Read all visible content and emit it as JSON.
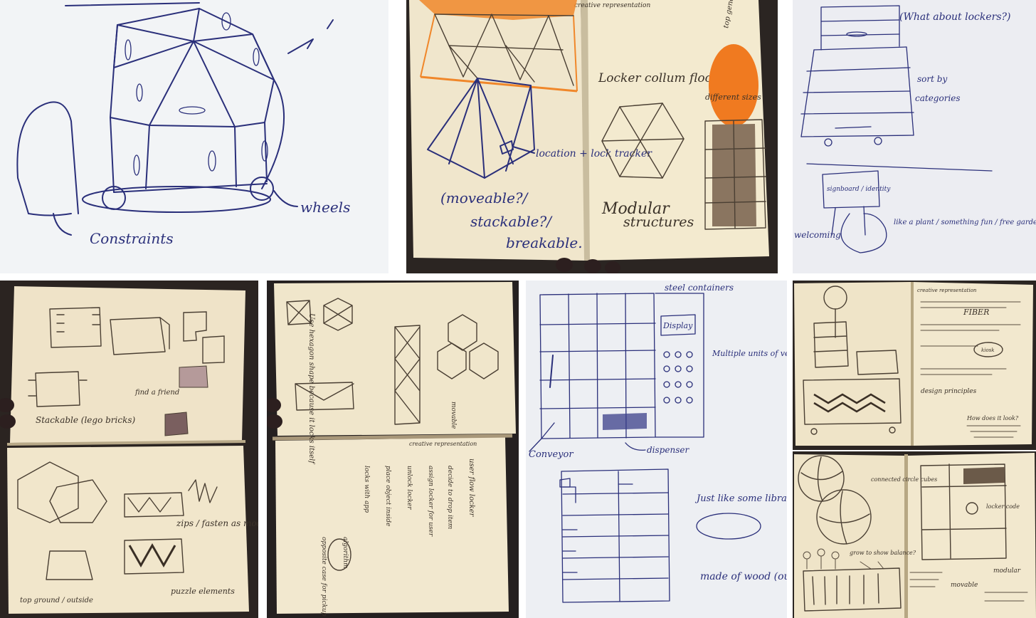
{
  "photos": {
    "sketch_1": {
      "subject": "hexagonal dome locker structure on wheels",
      "labels": {
        "constraints": "Constraints",
        "wheels": "wheels"
      }
    },
    "sketch_2": {
      "subject": "notebook spread with triangle canopy, locker column floor plan and stacked hexagonal lockers",
      "labels": {
        "header": "creative representation",
        "floor_plan": "Locker collum floor plan:",
        "location_lock": "location + lock tracker",
        "movable": "(moveable?/",
        "stackable": "stackable?/",
        "breakable": "breakable.",
        "modular": "Modular",
        "structures": "structures",
        "different_sizes": "different sizes",
        "top_note": "top generally cold?"
      }
    },
    "sketch_3": {
      "subject": "tall stacked shelving unit with pedestal and signage",
      "labels": {
        "what_about_lockers": "(What about lockers?)",
        "sort_by": "sort by",
        "categories": "categories",
        "signboard": "signboard / identity",
        "welcoming": "welcoming",
        "like_a_plant": "like a plant / something fun / free gardens"
      }
    },
    "sketch_4": {
      "subject": "notebook with modular furniture and puzzle-piece sketches",
      "labels": {
        "stackable_lego": "Stackable (lego bricks)",
        "zip_fasten": "zips / fasten as modular elements?",
        "puzzle": "puzzle elements",
        "top_side": "top ground / outside",
        "find_friends": "find a friend"
      }
    },
    "sketch_5": {
      "subject": "notebook spread with hexagon structures and user flow",
      "labels": {
        "header": "creative representation",
        "hexagon_note": "Use hexagon shape because it locks itself",
        "flow_start": "user flow locker",
        "movable": "movable",
        "assign": "assign locker for user",
        "decide": "decide to drop item",
        "unlock": "unlock locker",
        "place": "place object inside",
        "algorithm": "algorithm",
        "lock": "locks with app",
        "opposite": "opposite case for pickup"
      }
    },
    "sketch_6": {
      "subject": "grid vending machine layout and shelf diagram",
      "labels": {
        "steel": "steel containers",
        "display": "Display",
        "buttons": "Multiple units of vending machines",
        "dispenser": "dispenser",
        "conveyor": "Conveyor",
        "library": "Just like some library (in very small one)",
        "wood": "made of wood (outside?)"
      }
    },
    "sketch_7": {
      "subject": "notebook page with lamp, stacked boxes and woven bench",
      "labels": {
        "header": "creative representation",
        "kiosk": "kiosk",
        "design_principles": "design principles",
        "fiber": "FIBER",
        "how_does_it_look": "How does it look?"
      }
    },
    "sketch_8": {
      "subject": "notebook page with connected circles and modular cabinet",
      "labels": {
        "connected": "connected circle cubes",
        "grow": "grow to show balance?",
        "movable": "movable",
        "locker_code": "locker code",
        "modular": "modular"
      }
    }
  },
  "palette": {
    "ballpoint": "#2a2f7a",
    "pencil": "#4a3f33",
    "paper_white": "#f4f4f6",
    "paper_cream": "#f2e8cf",
    "orange": "#f0872a",
    "dark_bg": "#2b2522"
  }
}
